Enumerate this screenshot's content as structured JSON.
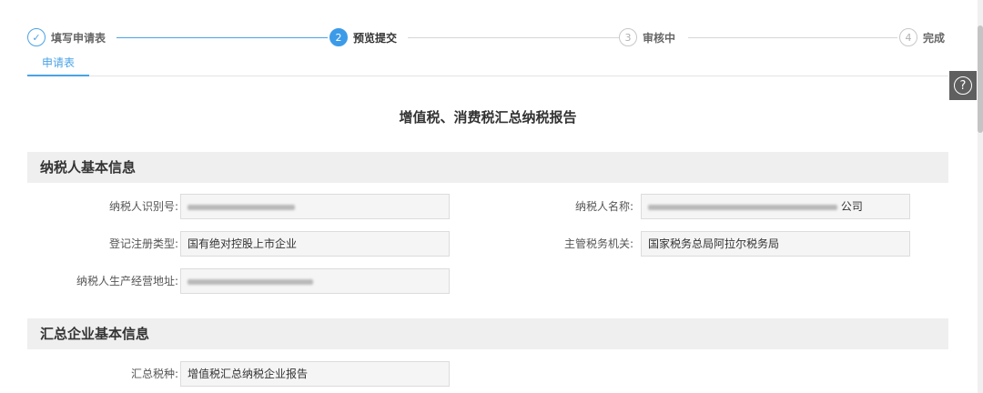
{
  "steps": [
    {
      "number": "✓",
      "label": "填写申请表",
      "state": "done"
    },
    {
      "number": "2",
      "label": "预览提交",
      "state": "active"
    },
    {
      "number": "3",
      "label": "审核中",
      "state": "pending"
    },
    {
      "number": "4",
      "label": "完成",
      "state": "pending"
    }
  ],
  "tabs": [
    {
      "label": "申请表"
    }
  ],
  "help_icon": "?",
  "report_title": "增值税、消费税汇总纳税报告",
  "sections": {
    "basic": {
      "title": "纳税人基本信息",
      "fields": {
        "tax_id": {
          "label": "纳税人识别号:",
          "value": ""
        },
        "name": {
          "label": "纳税人名称:",
          "value": "公司"
        },
        "reg_type": {
          "label": "登记注册类型:",
          "value": "国有绝对控股上市企业"
        },
        "authority": {
          "label": "主管税务机关:",
          "value": "国家税务总局阿拉尔税务局"
        },
        "address": {
          "label": "纳税人生产经营地址:",
          "value": ""
        }
      }
    },
    "summary": {
      "title": "汇总企业基本信息",
      "fields": {
        "tax_type": {
          "label": "汇总税种:",
          "value": "增值税汇总纳税企业报告"
        }
      }
    }
  }
}
